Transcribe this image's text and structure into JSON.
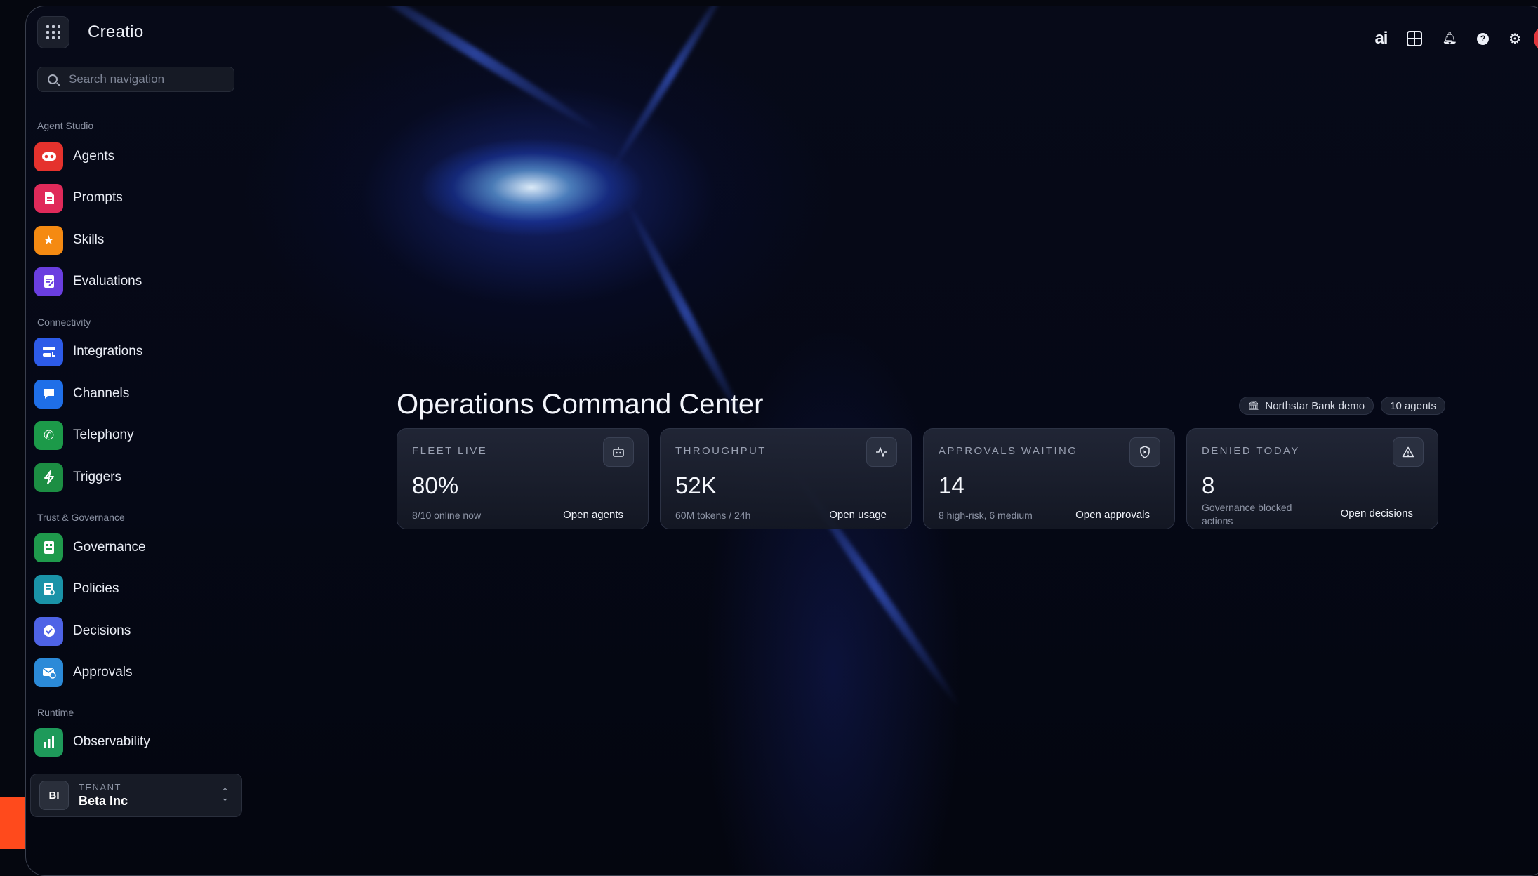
{
  "app": {
    "logo": "Creatio"
  },
  "search": {
    "placeholder": "Search navigation"
  },
  "sidebar": {
    "sections": [
      {
        "label": "Agent Studio"
      },
      {
        "label": "Connectivity"
      },
      {
        "label": "Trust & Governance"
      },
      {
        "label": "Runtime"
      }
    ],
    "items": [
      {
        "label": "Agents",
        "icon": "robot-icon",
        "color": "#e5322d"
      },
      {
        "label": "Prompts",
        "icon": "document-icon",
        "color": "#e02a5a"
      },
      {
        "label": "Skills",
        "icon": "star-icon",
        "color": "#f58a12"
      },
      {
        "label": "Evaluations",
        "icon": "clipboard-icon",
        "color": "#6a3ee0"
      },
      {
        "label": "Integrations",
        "icon": "integration-icon",
        "color": "#2d5be8"
      },
      {
        "label": "Channels",
        "icon": "chat-icon",
        "color": "#1f6fe8"
      },
      {
        "label": "Telephony",
        "icon": "phone-icon",
        "color": "#1c9a49"
      },
      {
        "label": "Triggers",
        "icon": "lightning-icon",
        "color": "#1c8e43"
      },
      {
        "label": "Governance",
        "icon": "governance-icon",
        "color": "#1f9a4c"
      },
      {
        "label": "Policies",
        "icon": "policy-icon",
        "color": "#1a93a8"
      },
      {
        "label": "Decisions",
        "icon": "check-circle-icon",
        "color": "#4e63e6"
      },
      {
        "label": "Approvals",
        "icon": "mail-check-icon",
        "color": "#2b8ad8"
      },
      {
        "label": "Observability",
        "icon": "bar-chart-icon",
        "color": "#1e9a5a"
      }
    ]
  },
  "tenant": {
    "caption": "TENANT",
    "name": "Beta Inc",
    "initials": "BI"
  },
  "topbar": {
    "ai_label": "ai"
  },
  "main": {
    "title": "Operations Command Center",
    "chips": {
      "org": "Northstar Bank demo",
      "agents": "10 agents"
    },
    "cards": [
      {
        "title": "FLEET LIVE",
        "value": "80%",
        "sub": "8/10 online now",
        "link": "Open agents",
        "icon": "robot-icon"
      },
      {
        "title": "THROUGHPUT",
        "value": "52K",
        "sub": "60M tokens / 24h",
        "link": "Open usage",
        "icon": "activity-icon"
      },
      {
        "title": "APPROVALS WAITING",
        "value": "14",
        "sub": "8 high-risk, 6 medium",
        "link": "Open approvals",
        "icon": "shield-icon"
      },
      {
        "title": "DENIED TODAY",
        "value": "8",
        "sub": "Governance blocked actions",
        "link": "Open decisions",
        "icon": "warning-icon"
      }
    ]
  }
}
